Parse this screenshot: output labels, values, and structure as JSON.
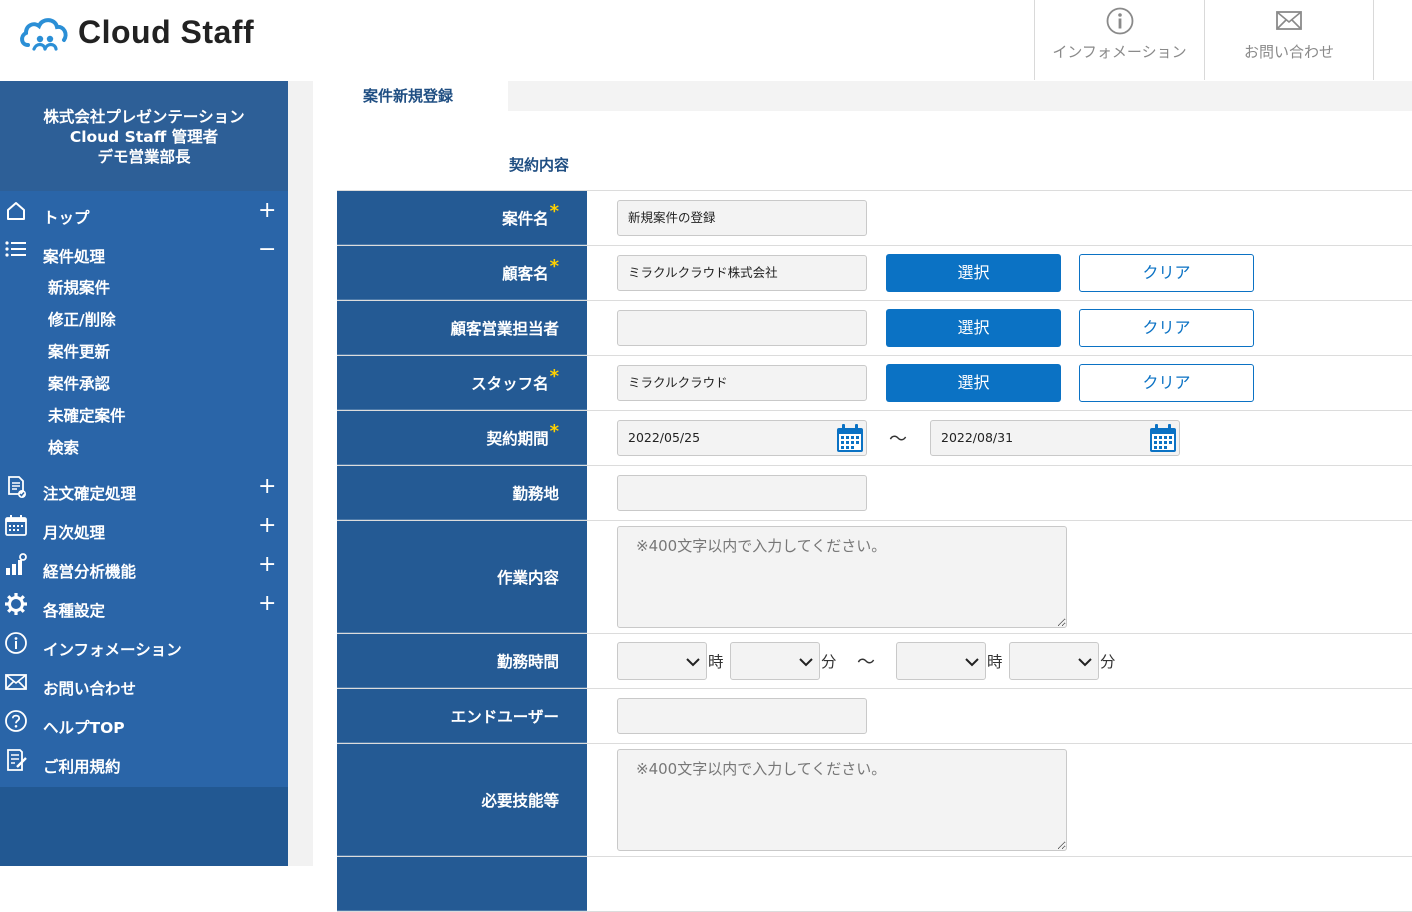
{
  "header": {
    "logo_text": "Cloud Staff",
    "nav": [
      {
        "label": "インフォメーション",
        "icon": "info-icon"
      },
      {
        "label": "お問い合わせ",
        "icon": "mail-icon"
      }
    ]
  },
  "sidebar": {
    "company": "株式会社プレゼンテーション",
    "role": "Cloud Staff 管理者",
    "user": "デモ営業部長",
    "menu": [
      {
        "label": "トップ",
        "icon": "home-icon",
        "toggle": "+"
      },
      {
        "label": "案件処理",
        "icon": "list-icon",
        "toggle": "−"
      },
      {
        "label": "注文確定処理",
        "icon": "document-check-icon",
        "toggle": "+"
      },
      {
        "label": "月次処理",
        "icon": "calendar-icon",
        "toggle": "+"
      },
      {
        "label": "経営分析機能",
        "icon": "chart-icon",
        "toggle": "+"
      },
      {
        "label": "各種設定",
        "icon": "gear-icon",
        "toggle": "+"
      },
      {
        "label": "インフォメーション",
        "icon": "info-icon"
      },
      {
        "label": "お問い合わせ",
        "icon": "mail-icon"
      },
      {
        "label": "ヘルプTOP",
        "icon": "help-icon"
      },
      {
        "label": "ご利用規約",
        "icon": "terms-icon"
      }
    ],
    "submenu": [
      "新規案件",
      "修正/削除",
      "案件更新",
      "案件承認",
      "未確定案件",
      "検索"
    ]
  },
  "page": {
    "tab": "案件新規登録",
    "section": "契約内容"
  },
  "form": {
    "required_mark": "*",
    "select_label": "選択",
    "clear_label": "クリア",
    "fields": {
      "case_name": {
        "label": "案件名",
        "value": "新規案件の登録"
      },
      "customer": {
        "label": "顧客名",
        "value": "ミラクルクラウド株式会社"
      },
      "customer_rep": {
        "label": "顧客営業担当者",
        "value": ""
      },
      "staff": {
        "label": "スタッフ名",
        "value": "ミラクルクラウド"
      },
      "period": {
        "label": "契約期間",
        "start": "2022/05/25",
        "end": "2022/08/31",
        "sep": "〜"
      },
      "location": {
        "label": "勤務地",
        "value": ""
      },
      "work_content": {
        "label": "作業内容",
        "placeholder": "※400文字以内で入力してください。"
      },
      "work_hours": {
        "label": "勤務時間",
        "hour_unit": "時",
        "minute_unit": "分",
        "sep": "〜"
      },
      "end_user": {
        "label": "エンドユーザー",
        "value": ""
      },
      "skills": {
        "label": "必要技能等",
        "placeholder": "※400文字以内で入力してください。"
      }
    }
  },
  "colors": {
    "sidebar_dark": "#225892",
    "sidebar_menu": "#2a65a8",
    "label_bg": "#245a94",
    "primary_button": "#0b72c4",
    "required_star": "#ffd200"
  }
}
